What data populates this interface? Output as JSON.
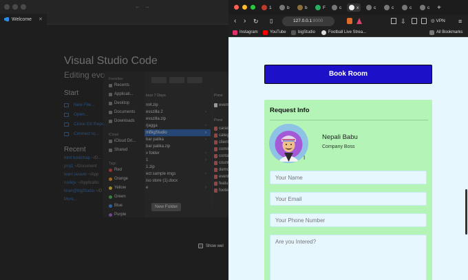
{
  "vscode": {
    "tab_label": "Welcome",
    "tab_close": "✕",
    "title": "Visual Studio Code",
    "subtitle": "Editing evo",
    "start_heading": "Start",
    "start_links": [
      "New File...",
      "Open...",
      "Clone Git Repo...",
      "Connect to..."
    ],
    "recent_heading": "Recent",
    "recent": [
      {
        "name": "html bootstrap",
        "path": "~/D..."
      },
      {
        "name": "proj1",
        "path": "~/Document"
      },
      {
        "name": "learn.laravel",
        "path": "~/App"
      },
      {
        "name": "nodejs",
        "path": "~/Applicatio"
      },
      {
        "name": "kiran@bigStudio",
        "path": "~/D"
      }
    ],
    "more": "More...",
    "show_welcome": "Show wel"
  },
  "finder": {
    "favorites_heading": "Favorites",
    "favorites": [
      "Recents",
      "Applicati...",
      "Desktop",
      "Documents",
      "Downloads"
    ],
    "icloud_heading": "iCloud",
    "icloud": [
      "iCloud Dri...",
      "Shared"
    ],
    "tags_heading": "Tags",
    "tags": [
      {
        "label": "Red",
        "color": "#e0443e"
      },
      {
        "label": "Orange",
        "color": "#f59a23"
      },
      {
        "label": "Yellow",
        "color": "#f5d33b"
      },
      {
        "label": "Green",
        "color": "#4cc15c"
      },
      {
        "label": "Blue",
        "color": "#3d8ef0"
      },
      {
        "label": "Purple",
        "color": "#a660d8"
      }
    ],
    "col1_heading": "ious 7 Days",
    "col1_items": [
      {
        "label": "nt4.zip",
        "folder": false,
        "selected": false
      },
      {
        "label": "esszilla 2",
        "folder": true,
        "selected": false
      },
      {
        "label": "esszilla.zip",
        "folder": false,
        "selected": false
      },
      {
        "label": "rjagga",
        "folder": true,
        "selected": false
      },
      {
        "label": "mBigStudio",
        "folder": true,
        "selected": true
      },
      {
        "label": "bar palika",
        "folder": true,
        "selected": false
      },
      {
        "label": "bar palika.zip",
        "folder": false,
        "selected": false
      },
      {
        "label": "v folder",
        "folder": true,
        "selected": false
      },
      {
        "label": "1",
        "folder": true,
        "selected": false
      },
      {
        "label": "1.zip",
        "folder": false,
        "selected": false
      },
      {
        "label": "ect sample imgs",
        "folder": true,
        "selected": false
      },
      {
        "label": "iso store (1).docx",
        "folder": false,
        "selected": false
      },
      {
        "label": "e",
        "folder": true,
        "selected": false
      }
    ],
    "col2_heading": "Previ",
    "col2_top": "evem",
    "col2_heading2": "Previ",
    "col2_items": [
      "carac",
      "categ",
      "client",
      "comin",
      "conta",
      "count",
      "demo",
      "event",
      "featu",
      "footer"
    ],
    "new_folder": "New Folder"
  },
  "browser": {
    "url_main": "127.0.0.1",
    "url_dim": ":8000",
    "tabs": [
      {
        "letter": "1",
        "color": "#c0392b"
      },
      {
        "letter": "b",
        "color": "#777"
      },
      {
        "letter": "b",
        "color": "#8a6d3b"
      },
      {
        "letter": "F",
        "color": "#27ae60"
      },
      {
        "letter": "c",
        "color": "#777"
      },
      {
        "letter": "x",
        "color": "#eee"
      },
      {
        "letter": "c",
        "color": "#777"
      },
      {
        "letter": "c",
        "color": "#777"
      },
      {
        "letter": "c",
        "color": "#777"
      },
      {
        "letter": "c",
        "color": "#777"
      }
    ],
    "new_tab": "+",
    "vpn": "VPN",
    "bookmarks": [
      {
        "label": "Instagram",
        "color": "#e1306c"
      },
      {
        "label": "YouTube",
        "color": "#ff0000"
      },
      {
        "label": "bigStudio",
        "color": "#555"
      },
      {
        "label": "Football Live Strea...",
        "color": "#ddd"
      }
    ],
    "all_bookmarks": "All Bookmarks"
  },
  "page": {
    "book_button": "Book Room",
    "card_title": "Request Info",
    "user_name": "Nepali Babu",
    "user_role": "Company Boss",
    "placeholders": {
      "name": "Your Name",
      "email": "Your Email",
      "phone": "Your Phone Number",
      "interest": "Are you Intered?"
    }
  }
}
